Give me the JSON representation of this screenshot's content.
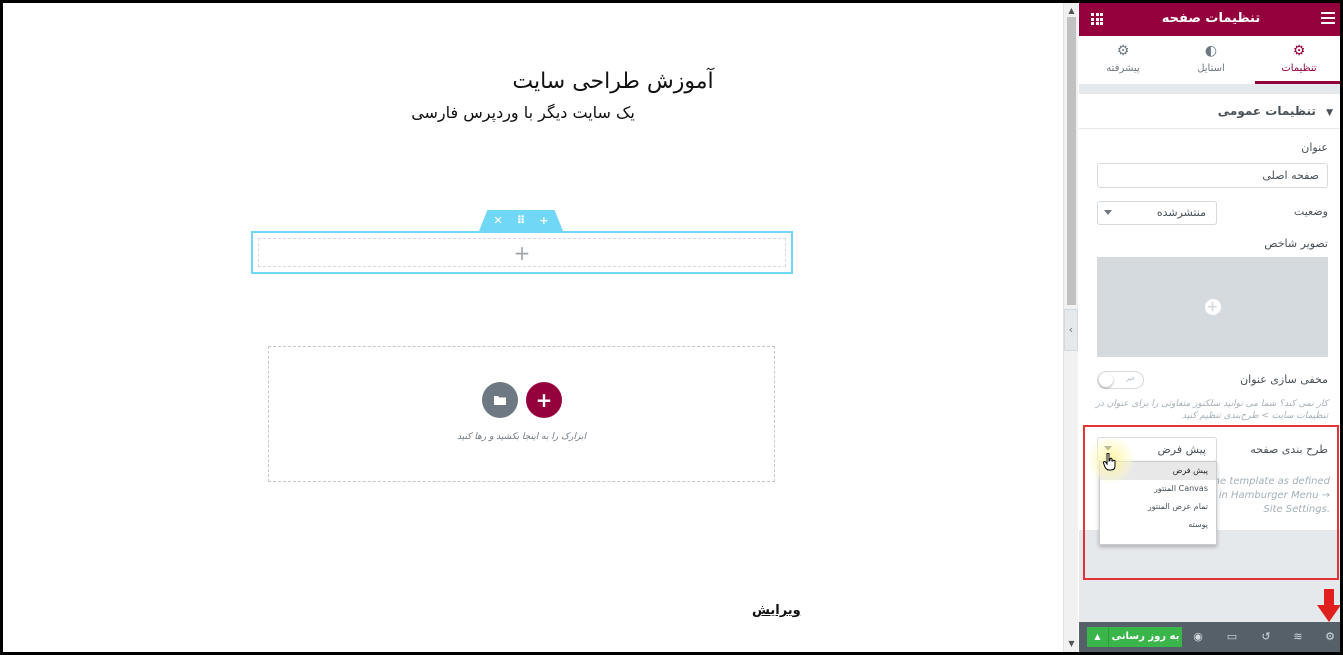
{
  "canvas": {
    "site_title": "آموزش طراحی سایت",
    "site_tagline": "یک سایت دیگر با وردپرس فارسی",
    "section_handle": {
      "add_icon": "plus-icon",
      "drag_icon": "drag-icon",
      "close_icon": "close-icon"
    },
    "section_add": "+",
    "drop_hint": "ابزارک را به اینجا بکشید و رها کنید",
    "edit_link": "ویرایش"
  },
  "panel": {
    "title": "تنظیمات صفحه",
    "tabs": [
      {
        "label": "تنظیمات",
        "icon": "gear-icon",
        "active": true
      },
      {
        "label": "استایل",
        "icon": "half-circle-icon",
        "active": false
      },
      {
        "label": "پیشرفته",
        "icon": "gear-icon",
        "active": false
      }
    ],
    "section_title": "تنظیمات عمومی",
    "title_label": "عنوان",
    "title_value": "صفحه اصلی",
    "status_label": "وضعیت",
    "status_value": "منتشرشده",
    "featured_image_label": "تصویر شاخص",
    "hide_title_label": "مخفی سازی عنوان",
    "hide_title_toggle_text": "خیر",
    "hide_title_help": "کار نمی کند؟ شما می توانید سلکتور متفاوتی را برای عنوان در تنظیمات سایت > طرح‌بندی تنظیم کنید",
    "layout_label": "طرح بندی صفحه",
    "layout_value": "پیش فرض",
    "layout_desc": "The template as defined in Hamburger Menu → Site Settings.",
    "layout_options": [
      "پیش فرض",
      "Canvas المنتور",
      "تمام عرض المنتور",
      "پوسته"
    ],
    "footer": {
      "update_label": "به روز رسانی"
    }
  },
  "colors": {
    "brand": "#93003c",
    "handle": "#71d7f7",
    "update": "#39b54a",
    "highlight": "#e23339"
  }
}
